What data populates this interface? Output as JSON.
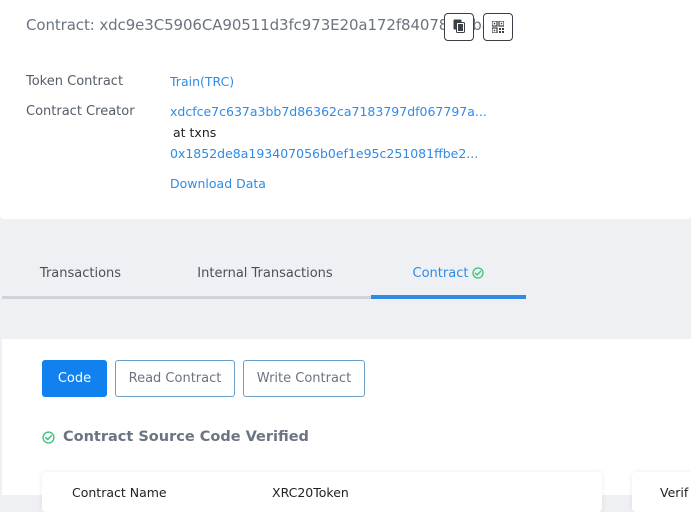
{
  "header": {
    "contract_title": "Contract: xdc9e3C5906CA90511d3fc973E20a172f8407871fba",
    "copy_icon": "copy-icon",
    "qr_icon": "qr-code-icon"
  },
  "details": {
    "token_contract_label": "Token Contract",
    "token_contract_value": "Train(TRC)",
    "creator_label": "Contract Creator",
    "creator_address": "xdcfce7c637a3bb7d86362ca7183797df067797a...",
    "at_txns": "at txns",
    "creation_tx": "0x1852de8a193407056b0ef1e95c251081ffbe2...",
    "download_label": "Download Data"
  },
  "tabs": [
    {
      "label": "Transactions",
      "active": false
    },
    {
      "label": "Internal Transactions",
      "active": false
    },
    {
      "label": "Contract",
      "active": true
    }
  ],
  "contract_panel": {
    "buttons": [
      {
        "label": "Code",
        "active": true
      },
      {
        "label": "Read Contract",
        "active": false
      },
      {
        "label": "Write Contract",
        "active": false
      }
    ],
    "verified_heading": "Contract Source Code Verified",
    "table": {
      "contract_name_label": "Contract Name",
      "contract_name_value": "XRC20Token",
      "right_label": "Verif"
    }
  },
  "colors": {
    "accent": "#1181ef",
    "link": "#2f8be6",
    "verified_green": "#3cc47c"
  }
}
